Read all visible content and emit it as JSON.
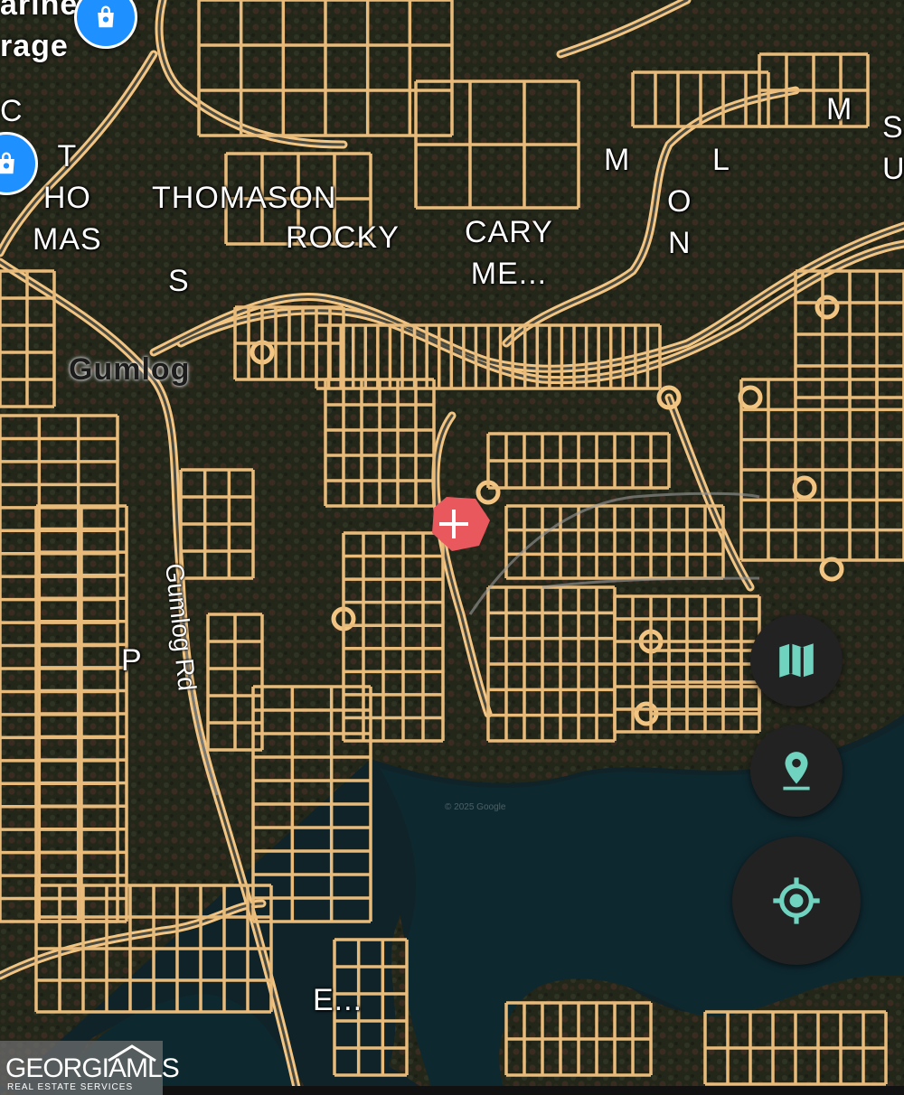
{
  "map": {
    "place_labels": {
      "gumlog": "Gumlog",
      "garage_partial": "arine\nrage",
      "c_partial": "C"
    },
    "road_labels": {
      "gumlog_rd": "Gumlog Rd"
    },
    "street_labels": {
      "t_ho_mas": "T\nHO\nMAS",
      "thomason": "THOMASON",
      "s": "S",
      "rocky": "ROCKY",
      "cary_me": "CARY\nME...",
      "m1": "M",
      "l": "L",
      "o_n": "O\nN",
      "m2": "M",
      "s_u": "S\nU",
      "p": "P",
      "e": "E..."
    },
    "watermark": "© 2025 Google"
  },
  "controls": {
    "map_type_icon": "map-icon",
    "location_pin_icon": "location-pin-icon",
    "my_location_icon": "crosshair-icon",
    "accent": "#6fd3bf"
  },
  "logo": {
    "main": "GEORGIAMLS",
    "sub": "REAL ESTATE SERVICES"
  },
  "marker": {
    "color": "#e8585c",
    "icon": "plus-icon"
  },
  "pin_color": "#1e90ff"
}
